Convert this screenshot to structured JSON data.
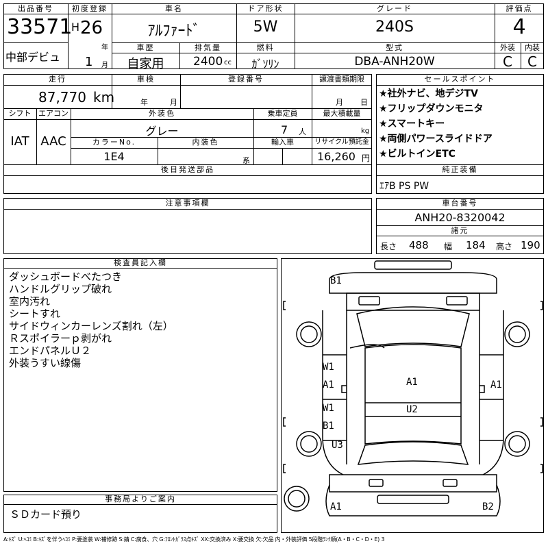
{
  "header": {
    "lot_label": "出品番号",
    "lot_number": "33571",
    "first_reg_label": "初度登録",
    "era": "H",
    "year": "26",
    "year_unit": "年",
    "month": "1",
    "month_unit": "月",
    "debut": "中部デビュ",
    "car_name_label": "車名",
    "car_name": "ｱﾙﾌｧｰﾄﾞ",
    "door_label": "ドア形状",
    "door": "5W",
    "grade_label": "グレード",
    "grade": "240S",
    "score_label": "評価点",
    "score": "4",
    "history_label": "車歴",
    "history": "自家用",
    "displacement_label": "排気量",
    "displacement": "2400",
    "displacement_unit": "cc",
    "fuel_label": "燃料",
    "fuel": "ｶﾞｿﾘﾝ",
    "model_label": "型式",
    "model": "DBA-ANH20W",
    "exterior_label": "外装",
    "exterior_grade": "C",
    "interior_label": "内装",
    "interior_grade": "C"
  },
  "mid": {
    "mileage_label": "走行",
    "mileage": "87,770",
    "mileage_unit": "km",
    "inspection_label": "車検",
    "insp_year_unit": "年",
    "insp_month_unit": "月",
    "reg_no_label": "登録番号",
    "transfer_label": "譲渡書類期限",
    "transfer_month": "月",
    "transfer_day": "日",
    "shift_label": "シフト",
    "shift": "IAT",
    "ac_label": "エアコン",
    "ac": "AAC",
    "ext_color_label": "外装色",
    "ext_color": "グレー",
    "capacity_label": "乗車定員",
    "capacity": "7",
    "capacity_unit": "人",
    "load_label": "最大積載量",
    "load_unit": "kg",
    "color_no_label": "カラーNo.",
    "color_no": "1E4",
    "int_color_label": "内装色",
    "int_color_unit": "系",
    "import_label": "輸入車",
    "recycle_label": "リサイクル預託金",
    "recycle": "16,260",
    "recycle_unit": "円",
    "later_parts_label": "後日発送部品"
  },
  "selling_points": {
    "label": "セールスポイント",
    "items": [
      "★社外ナビ、地デジTV",
      "★フリップダウンモニタ",
      "★スマートキー",
      "★両側パワースライドドア",
      "★ビルトインETC"
    ]
  },
  "equipment": {
    "label": "純正装備",
    "value": "ｴｱB PS PW"
  },
  "notes": {
    "label": "注意事項欄"
  },
  "chassis": {
    "label": "車台番号",
    "value": "ANH20-8320042",
    "spec_label": "諸元",
    "length_label": "長さ",
    "length": "488",
    "width_label": "幅",
    "width": "184",
    "height_label": "高さ",
    "height": "190"
  },
  "inspector": {
    "label": "検査員記入欄",
    "items": [
      "ダッシュボードべたつき",
      "ハンドルグリップ破れ",
      "室内汚れ",
      "シートすれ",
      "サイドウィンカーレンズ割れ（左）",
      "Ｒスポイラーｐ剥がれ",
      "エンドパネルＵ２",
      "外装うすい線傷"
    ]
  },
  "office": {
    "label": "事務局よりご案内",
    "text": "ＳＤカード預り"
  },
  "diagram": {
    "labels": [
      "B1",
      "W1",
      "A1",
      "A1",
      "A1",
      "W1",
      "U2",
      "B1",
      "U3",
      "A1",
      "B2"
    ]
  },
  "legend": "A:ｷｽﾞ U:ﾍｺﾐ B:ｷｽﾞを伴うﾍｺﾐ P:要塗装 W:補修跡 S:錆 C:腐食、穴 G:ﾌﾛﾝﾄｶﾞﾗｽ点ｷｽﾞ XX:交換済み X:要交換 欠:欠品 内・外装評価 5段階ﾗﾝｸ順(A・B・C・D・E) 3"
}
